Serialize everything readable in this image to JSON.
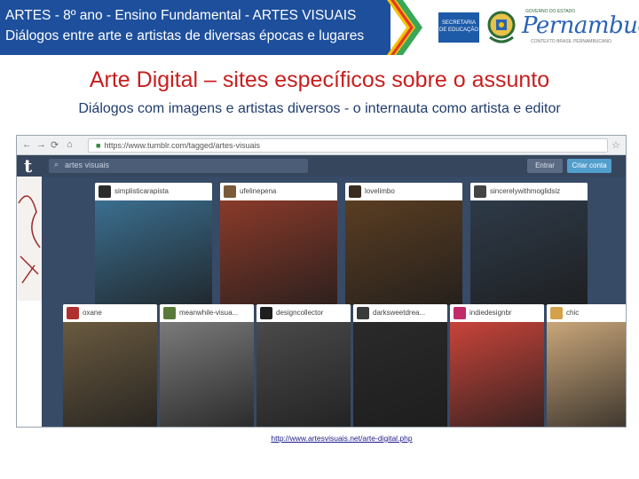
{
  "header": {
    "line1": "ARTES - 8º ano - Ensino Fundamental - ARTES VISUAIS",
    "line2": "Diálogos entre arte e artistas de diversas épocas e lugares",
    "secretaria": "SECRETARIA DE EDUCAÇÃO",
    "gov_small": "GOVERNO DO ESTADO",
    "state_logo": "Pernambuco",
    "state_sub": "CONTEXTO BRASIL PERNAMBUCANO"
  },
  "title": "Arte Digital – sites específicos sobre o assunto",
  "subtitle": "Diálogos com imagens e artistas diversos - o internauta como artista e editor",
  "browser": {
    "url": "https://www.tumblr.com/tagged/artes-visuais",
    "search_placeholder": "artes visuais",
    "entrar_label": "Entrar",
    "criar_label": "Criar conta",
    "logo": "t",
    "row1": [
      {
        "name": "simplisticarapista",
        "avatar_color": "#2b2b2b",
        "img_color": "#3b6e8f"
      },
      {
        "name": "ufelinepena",
        "avatar_color": "#7a5a3a",
        "img_color": "#8a3a2a"
      },
      {
        "name": "lovelimbo",
        "avatar_color": "#3a2d20",
        "img_color": "#5a3d22"
      },
      {
        "name": "sincerelywithmoglidsiz",
        "avatar_color": "#444444",
        "img_color": "#2e3a48"
      }
    ],
    "row2": [
      {
        "name": "oxane",
        "avatar_color": "#b03030",
        "img_color": "#6a5a40"
      },
      {
        "name": "meanwhile-visua...",
        "avatar_color": "#5a7a3a",
        "img_color": "#7a7a7a"
      },
      {
        "name": "designcollector",
        "avatar_color": "#1e1e1e",
        "img_color": "#4a4a4a"
      },
      {
        "name": "darksweetdrea...",
        "avatar_color": "#3a3a3a",
        "img_color": "#2a2a2a"
      },
      {
        "name": "indiedesignbr",
        "avatar_color": "#c22a6a",
        "img_color": "#c8443a"
      },
      {
        "name": "chic",
        "avatar_color": "#d4a24a",
        "img_color": "#c9a67a"
      }
    ]
  },
  "link": "http://www.artesvisuais.net/arte-digital.php"
}
